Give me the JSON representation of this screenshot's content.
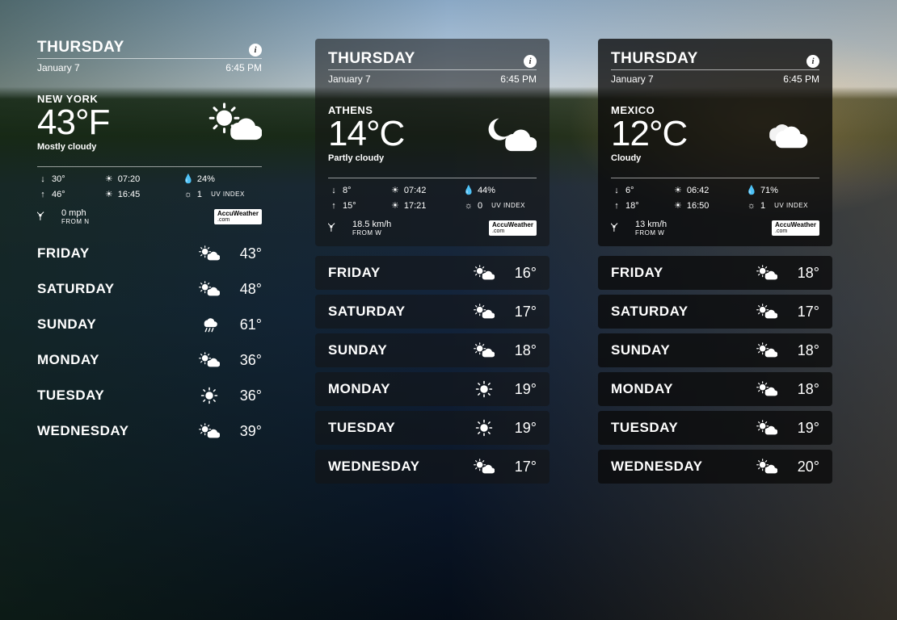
{
  "common": {
    "day": "THURSDAY",
    "date": "January 7",
    "time": "6:45 PM",
    "uv_label": "UV INDEX",
    "from_prefix": "FROM",
    "accu_top": "Accu",
    "accu_mid": "Weather",
    "accu_bot": ".com"
  },
  "widgets": [
    {
      "style": "plain",
      "city": "NEW YORK",
      "temp": "43°F",
      "condition": "Mostly cloudy",
      "icon": "partly-cloudy",
      "low": "30°",
      "high": "46°",
      "sunrise": "07:20",
      "sunset": "16:45",
      "humidity": "24%",
      "uv": "1",
      "wind_speed": "0 mph",
      "wind_from": "N",
      "forecast": [
        {
          "day": "FRIDAY",
          "icon": "partly-cloudy",
          "temp": "43°"
        },
        {
          "day": "SATURDAY",
          "icon": "partly-cloudy",
          "temp": "48°"
        },
        {
          "day": "SUNDAY",
          "icon": "rain",
          "temp": "61°"
        },
        {
          "day": "MONDAY",
          "icon": "partly-cloudy",
          "temp": "36°"
        },
        {
          "day": "TUESDAY",
          "icon": "sunny",
          "temp": "36°"
        },
        {
          "day": "WEDNESDAY",
          "icon": "partly-cloudy",
          "temp": "39°"
        }
      ]
    },
    {
      "style": "panel",
      "city": "ATHENS",
      "temp": "14°C",
      "condition": "Partly cloudy",
      "icon": "night-cloudy",
      "low": "8°",
      "high": "15°",
      "sunrise": "07:42",
      "sunset": "17:21",
      "humidity": "44%",
      "uv": "0",
      "wind_speed": "18.5 km/h",
      "wind_from": "W",
      "forecast": [
        {
          "day": "FRIDAY",
          "icon": "partly-cloudy",
          "temp": "16°"
        },
        {
          "day": "SATURDAY",
          "icon": "partly-cloudy",
          "temp": "17°"
        },
        {
          "day": "SUNDAY",
          "icon": "partly-cloudy",
          "temp": "18°"
        },
        {
          "day": "MONDAY",
          "icon": "sunny",
          "temp": "19°"
        },
        {
          "day": "TUESDAY",
          "icon": "sunny",
          "temp": "19°"
        },
        {
          "day": "WEDNESDAY",
          "icon": "partly-cloudy",
          "temp": "17°"
        }
      ]
    },
    {
      "style": "panel-dark",
      "city": "MEXICO",
      "temp": "12°C",
      "condition": "Cloudy",
      "icon": "cloudy",
      "low": "6°",
      "high": "18°",
      "sunrise": "06:42",
      "sunset": "16:50",
      "humidity": "71%",
      "uv": "1",
      "wind_speed": "13 km/h",
      "wind_from": "W",
      "forecast": [
        {
          "day": "FRIDAY",
          "icon": "partly-cloudy",
          "temp": "18°"
        },
        {
          "day": "SATURDAY",
          "icon": "partly-cloudy",
          "temp": "17°"
        },
        {
          "day": "SUNDAY",
          "icon": "partly-cloudy",
          "temp": "18°"
        },
        {
          "day": "MONDAY",
          "icon": "partly-cloudy",
          "temp": "18°"
        },
        {
          "day": "TUESDAY",
          "icon": "partly-cloudy",
          "temp": "19°"
        },
        {
          "day": "WEDNESDAY",
          "icon": "partly-cloudy",
          "temp": "20°"
        }
      ]
    }
  ]
}
